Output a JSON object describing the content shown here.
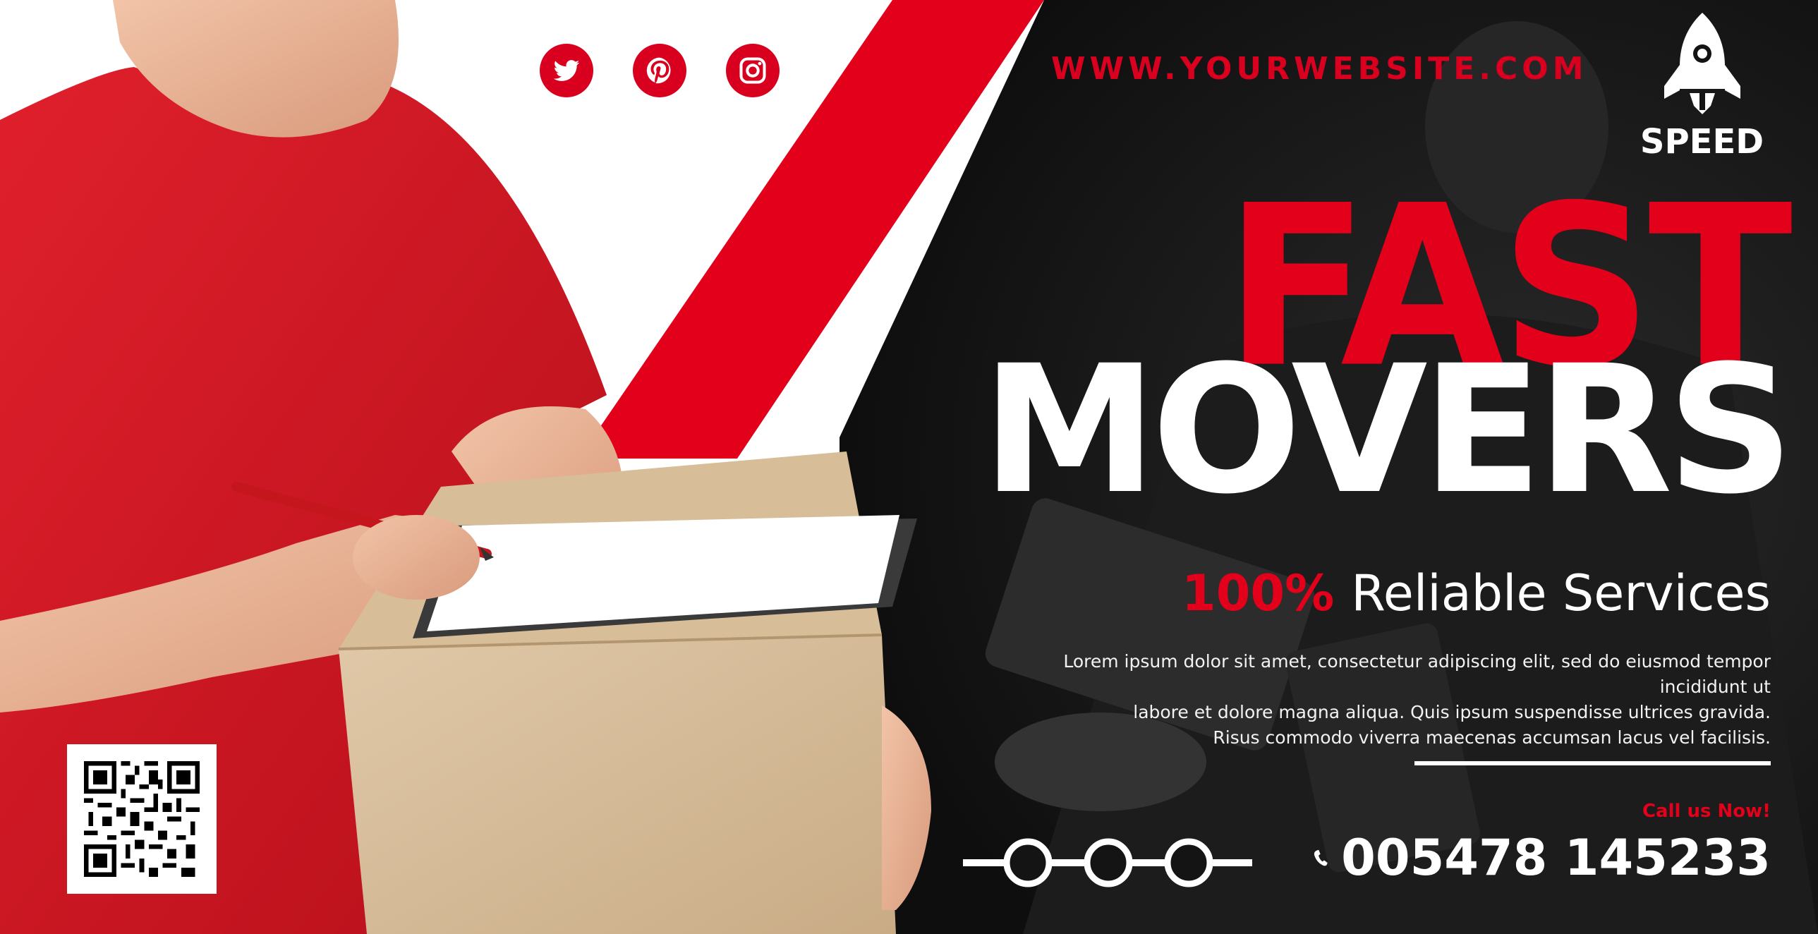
{
  "social": {
    "icons": [
      "twitter-icon",
      "pinterest-icon",
      "instagram-icon"
    ]
  },
  "website": "WWW.YOURWEBSITE.COM",
  "badge": {
    "icon": "rocket-icon",
    "label": "SPEED"
  },
  "headline": {
    "line1": "FAST",
    "line2": "MOVERS"
  },
  "tagline": {
    "percent": "100%",
    "text": "Reliable Services"
  },
  "body": {
    "line1": "Lorem ipsum dolor sit amet, consectetur adipiscing elit, sed do eiusmod tempor incididunt ut",
    "line2": "labore et dolore magna aliqua. Quis ipsum suspendisse ultrices gravida.",
    "line3": "Risus commodo viverra maecenas accumsan lacus vel facilisis."
  },
  "contact": {
    "call_label": "Call us Now!",
    "phone": "005478 145233",
    "phone_icon": "phone-icon"
  },
  "colors": {
    "accent": "#e3001b",
    "dark": "#141414",
    "white": "#ffffff"
  }
}
